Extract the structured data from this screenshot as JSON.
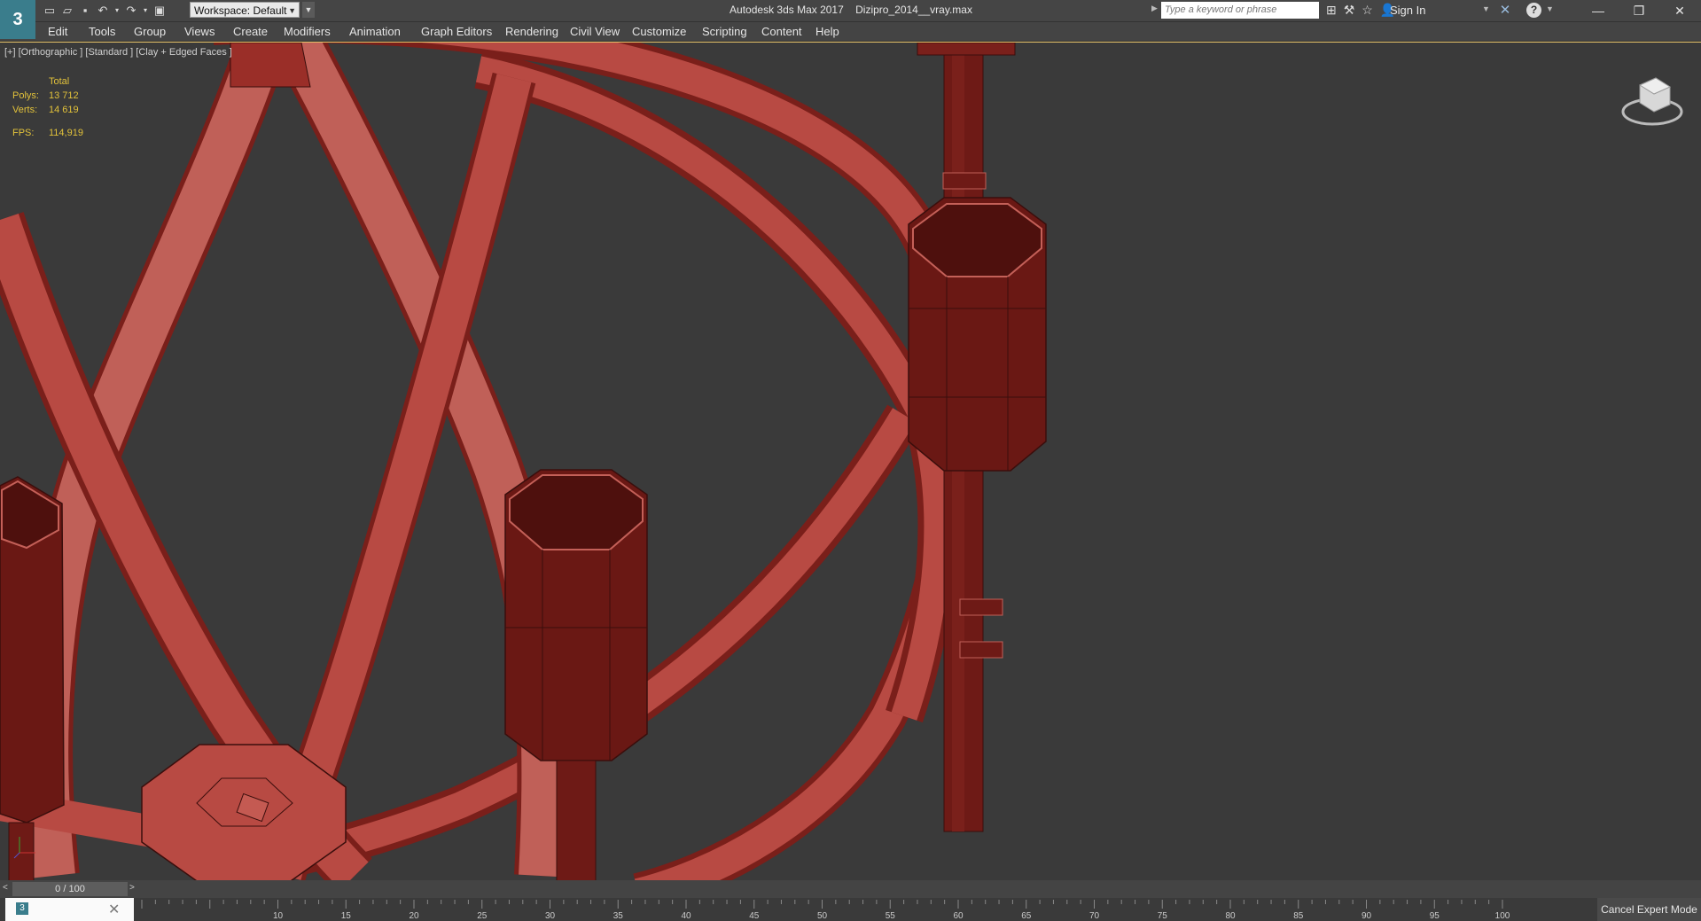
{
  "app": {
    "logo_text": "3",
    "title": "Autodesk 3ds Max 2017",
    "file_name": "Dizipro_2014__vray.max",
    "workspace_label": "Workspace: Default"
  },
  "search": {
    "placeholder": "Type a keyword or phrase"
  },
  "account": {
    "sign_in": "Sign In"
  },
  "menu": [
    "Edit",
    "Tools",
    "Group",
    "Views",
    "Create",
    "Modifiers",
    "Animation",
    "Graph Editors",
    "Rendering",
    "Civil View",
    "Customize",
    "Scripting",
    "Content",
    "Help"
  ],
  "viewport": {
    "label": "[+] [Orthographic ] [Standard ] [Clay + Edged Faces ]",
    "stats": {
      "total_label": "Total",
      "polys_label": "Polys:",
      "polys_value": "13 712",
      "verts_label": "Verts:",
      "verts_value": "14 619",
      "fps_label": "FPS:",
      "fps_value": "114,919"
    },
    "model_color": "#b84a43"
  },
  "timeline": {
    "frame_counter": "0 / 100",
    "ticks": [
      "10",
      "15",
      "20",
      "25",
      "30",
      "35",
      "40",
      "45",
      "50",
      "55",
      "60",
      "65",
      "70",
      "75",
      "80",
      "85",
      "90",
      "95",
      "100"
    ]
  },
  "footer": {
    "cancel_expert": "Cancel Expert Mode"
  },
  "colors": {
    "accent": "#e8c46a",
    "stats": "#e2c23a",
    "background": "#3a3a3a"
  }
}
